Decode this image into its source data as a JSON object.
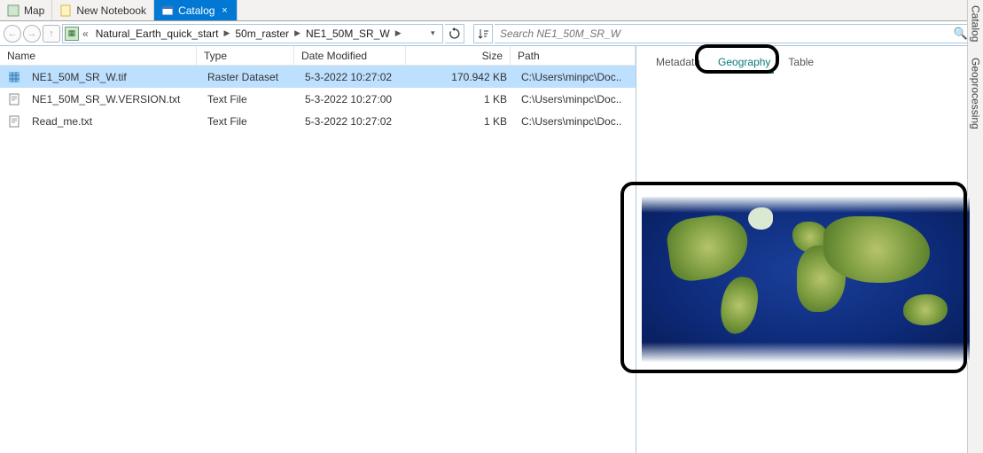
{
  "doc_tabs": [
    {
      "label": "Map",
      "icon": "map",
      "active": false
    },
    {
      "label": "New Notebook",
      "icon": "notebook",
      "active": false
    },
    {
      "label": "Catalog",
      "icon": "catalog",
      "active": true
    }
  ],
  "side_tabs": {
    "catalog": "Catalog",
    "geoprocessing": "Geoprocessing"
  },
  "breadcrumb": {
    "prefix": "«",
    "items": [
      "Natural_Earth_quick_start",
      "50m_raster",
      "NE1_50M_SR_W"
    ]
  },
  "search": {
    "placeholder": "Search NE1_50M_SR_W"
  },
  "columns": {
    "name": "Name",
    "type": "Type",
    "date": "Date Modified",
    "size": "Size",
    "path": "Path"
  },
  "rows": [
    {
      "name": "NE1_50M_SR_W.tif",
      "type": "Raster Dataset",
      "date": "5-3-2022 10:27:02",
      "size": "170.942 KB",
      "path": "C:\\Users\\minpc\\Doc..",
      "icon": "raster",
      "selected": true
    },
    {
      "name": "NE1_50M_SR_W.VERSION.txt",
      "type": "Text File",
      "date": "5-3-2022 10:27:00",
      "size": "1 KB",
      "path": "C:\\Users\\minpc\\Doc..",
      "icon": "txt",
      "selected": false
    },
    {
      "name": "Read_me.txt",
      "type": "Text File",
      "date": "5-3-2022 10:27:02",
      "size": "1 KB",
      "path": "C:\\Users\\minpc\\Doc..",
      "icon": "txt",
      "selected": false
    }
  ],
  "detail_tabs": {
    "metadata": "Metadata",
    "geography": "Geography",
    "table": "Table",
    "active": "geography"
  }
}
